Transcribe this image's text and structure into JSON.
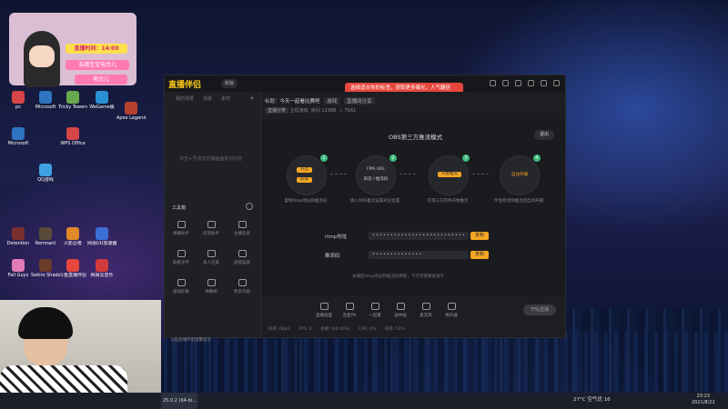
{
  "desktop": {
    "icons": [
      {
        "label": "pc",
        "color": "#d64545"
      },
      {
        "label": "Microsoft",
        "color": "#2f74c0"
      },
      {
        "label": "Tricky Towers",
        "color": "#6aa84f"
      },
      {
        "label": "WeGame版",
        "color": "#2b91d6"
      },
      {
        "label": "Microsoft",
        "color": "#2f74c0"
      },
      {
        "label": "WPS Office",
        "color": "#d64545"
      },
      {
        "label": "Apex Legends",
        "color": "#b7412e"
      },
      {
        "label": "QQ游戏",
        "color": "#3ea3e3"
      },
      {
        "label": "Detention",
        "color": "#7a2e2e"
      },
      {
        "label": "Remnant",
        "color": "#5a4a3a"
      },
      {
        "label": "火影忍者",
        "color": "#e08a2a"
      },
      {
        "label": "网易UU加速器",
        "color": "#3b6fd6"
      },
      {
        "label": "Fall Guys",
        "color": "#e07ab8"
      },
      {
        "label": "Sekiro Shadow...",
        "color": "#6b3b2a"
      },
      {
        "label": "斗鱼直播伴侣",
        "color": "#e8473e"
      },
      {
        "label": "网易云音乐",
        "color": "#d23b3b"
      }
    ]
  },
  "overlay": {
    "time_label": "直播时间：14:00",
    "line1": "浩瀚宝宝电台儿",
    "line2": "电台儿"
  },
  "app": {
    "logo": "直播伴侣",
    "version": "新版",
    "promo": "选择适合你的标签，获取更多曝光，人气翻倍",
    "left_tabs": [
      "我的场景",
      "场景",
      "素材"
    ],
    "left_hint": "点击+号添加直播画面素材内容",
    "tools_title": "工具箱",
    "tools": [
      {
        "label": "弹幕助手"
      },
      {
        "label": "房管助手"
      },
      {
        "label": "主播任务"
      },
      {
        "label": "贴纸文字"
      },
      {
        "label": "多人连麦"
      },
      {
        "label": "滤镜美颜"
      },
      {
        "label": "虚拟形象"
      },
      {
        "label": "弹幕姬"
      },
      {
        "label": "更多功能"
      }
    ],
    "info": {
      "title_label": "标题：",
      "title_value": "今天一起看比赛吧",
      "tag": "游戏",
      "share": "直播间分享",
      "category_label": "直播分类",
      "category": "主机游戏",
      "room_label": "房间",
      "room": "12388",
      "heat": "7561"
    },
    "obs": {
      "title": "OBS第三方推流模式",
      "back": "退出",
      "steps": [
        {
          "num": "1",
          "pill_a": "开启",
          "pill_b": "获取",
          "caption": "复制rtmp地址和推流码"
        },
        {
          "num": "2",
          "pill_a": "FMS URL",
          "pill_b": "串流 / 推流码",
          "caption": "填入OBS推流设置对应位置"
        },
        {
          "num": "3",
          "pill_a": "开始推流",
          "pill_b": "",
          "caption": "在第三方软件开始推流"
        },
        {
          "num": "4",
          "pill_a": "自动开播",
          "pill_b": "",
          "caption": "伴侣检测到推流后自动开播"
        }
      ],
      "rtmp_label": "rtmp地址",
      "rtmp_value": "••••••••••••••••••••••••••",
      "key_label": "推流码",
      "key_value": "••••••••••••••",
      "copy": "复制",
      "note": "关播后rtmp地址和推流码刷新，下次无需重复填写"
    },
    "bottom_tools": [
      {
        "label": "直播画面"
      },
      {
        "label": "连麦PK"
      },
      {
        "label": "一起看"
      },
      {
        "label": "画中画"
      },
      {
        "label": "麦克风"
      },
      {
        "label": "扬声器"
      }
    ],
    "go_live": "开始直播",
    "status": [
      "码率: 0kb/s",
      "FPS: 0",
      "丢帧: 0(0.00%)",
      "CPU: 4%",
      "内存: 52%"
    ],
    "chat_line": "斗鱼直播伴侣温馨提示"
  },
  "taskbar": {
    "task": "25.0.2 (64-bi...",
    "weather": "27°C 空气优 16",
    "time": "23:23",
    "date": "2021/8/22"
  }
}
